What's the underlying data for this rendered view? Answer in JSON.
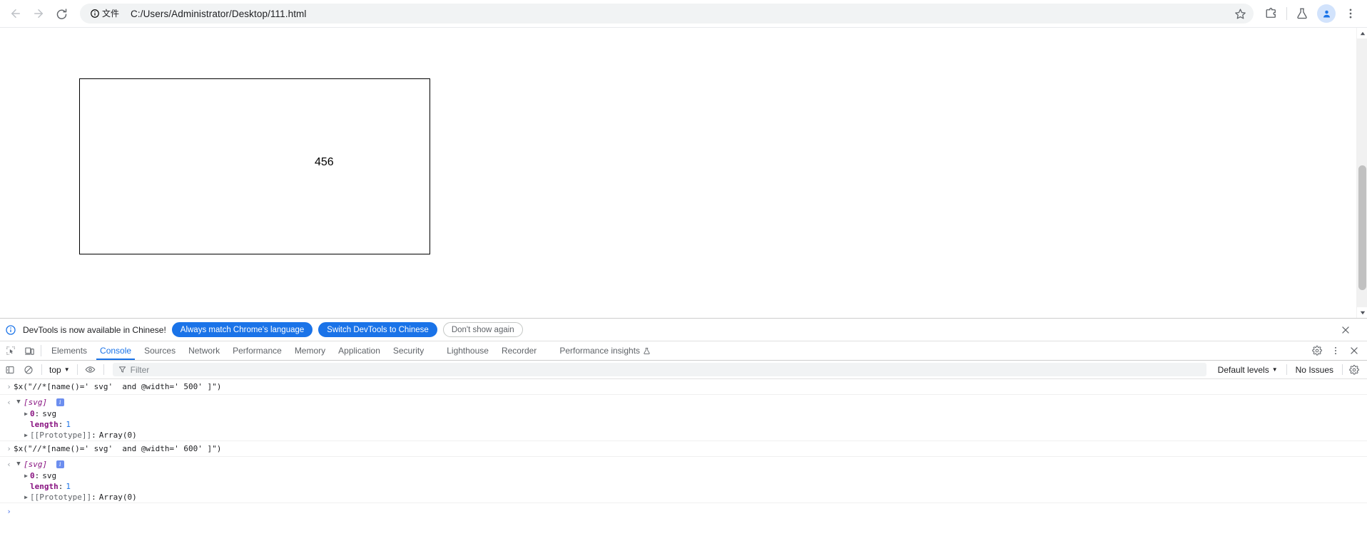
{
  "browser": {
    "nav": {
      "back_label": "Back",
      "forward_label": "Forward",
      "reload_label": "Reload"
    },
    "omnibox": {
      "site_chip_label": "文件",
      "site_chip_icon": "info-circle-icon",
      "url": "C:/Users/Administrator/Desktop/111.html",
      "star_icon": "star-icon"
    },
    "toolbar_icons": [
      {
        "name": "extensions-puzzle-icon",
        "label": "Extensions"
      },
      {
        "name": "flask-icon",
        "label": "Experiments"
      },
      {
        "name": "profile-avatar-icon",
        "label": "Profile"
      },
      {
        "name": "three-dot-menu-icon",
        "label": "Customize and control"
      }
    ]
  },
  "page": {
    "svg_text": "456",
    "scrollbar": {
      "up_arrow": "▲",
      "down_arrow": "▼"
    }
  },
  "devtools": {
    "notice": {
      "info_icon": "info-circle-icon",
      "message": "DevTools is now available in Chinese!",
      "buttons": [
        {
          "label": "Always match Chrome's language",
          "style": "primary"
        },
        {
          "label": "Switch DevTools to Chinese",
          "style": "primary"
        },
        {
          "label": "Don't show again",
          "style": "ghost"
        }
      ],
      "close_icon": "close-icon"
    },
    "tabs": {
      "inspect_icon": "inspect-element-icon",
      "device_icon": "device-toolbar-icon",
      "items": [
        {
          "label": "Elements",
          "active": false
        },
        {
          "label": "Console",
          "active": true
        },
        {
          "label": "Sources",
          "active": false
        },
        {
          "label": "Network",
          "active": false
        },
        {
          "label": "Performance",
          "active": false
        },
        {
          "label": "Memory",
          "active": false
        },
        {
          "label": "Application",
          "active": false
        },
        {
          "label": "Security",
          "active": false
        },
        {
          "label": "Lighthouse",
          "active": false
        },
        {
          "label": "Recorder",
          "active": false
        },
        {
          "label": "Performance insights",
          "active": false,
          "trailing_icon": "flask-icon"
        }
      ],
      "right_icons": [
        {
          "name": "settings-gear-icon"
        },
        {
          "name": "more-options-icon"
        },
        {
          "name": "close-devtools-icon"
        }
      ]
    },
    "console_toolbar": {
      "sidebar_icon": "console-sidebar-icon",
      "clear_icon": "clear-console-icon",
      "context_selector": "top",
      "context_caret": "▼",
      "eye_icon": "live-expression-icon",
      "filter_icon": "filter-icon",
      "filter_placeholder": "Filter",
      "levels_label": "Default levels",
      "levels_caret": "▼",
      "issues_label": "No Issues",
      "settings_icon": "settings-gear-icon"
    },
    "console_entries": [
      {
        "command": "$x(\"//*[name()=' svg'  and @width=' 500' ]\")",
        "result_label": "[svg]",
        "info_badge": "i",
        "properties": [
          {
            "toggle": "▶",
            "key": "0",
            "value": "svg",
            "kind": "object"
          },
          {
            "toggle": "",
            "key": "length",
            "value": "1",
            "kind": "number"
          },
          {
            "toggle": "▶",
            "key": "[[Prototype]]",
            "value": "Array(0)",
            "kind": "proto"
          }
        ]
      },
      {
        "command": "$x(\"//*[name()=' svg'  and @width=' 600' ]\")",
        "result_label": "[svg]",
        "info_badge": "i",
        "properties": [
          {
            "toggle": "▶",
            "key": "0",
            "value": "svg",
            "kind": "object"
          },
          {
            "toggle": "",
            "key": "length",
            "value": "1",
            "kind": "number"
          },
          {
            "toggle": "▶",
            "key": "[[Prototype]]",
            "value": "Array(0)",
            "kind": "proto"
          }
        ]
      }
    ],
    "prompt_arrow": "❯"
  },
  "colors": {
    "accent": "#1a73e8",
    "chrome_toolbar_bg": "#ffffff",
    "omnibox_bg": "#f1f3f4",
    "key_purple": "#881280",
    "number_blue": "#1a73e8"
  }
}
